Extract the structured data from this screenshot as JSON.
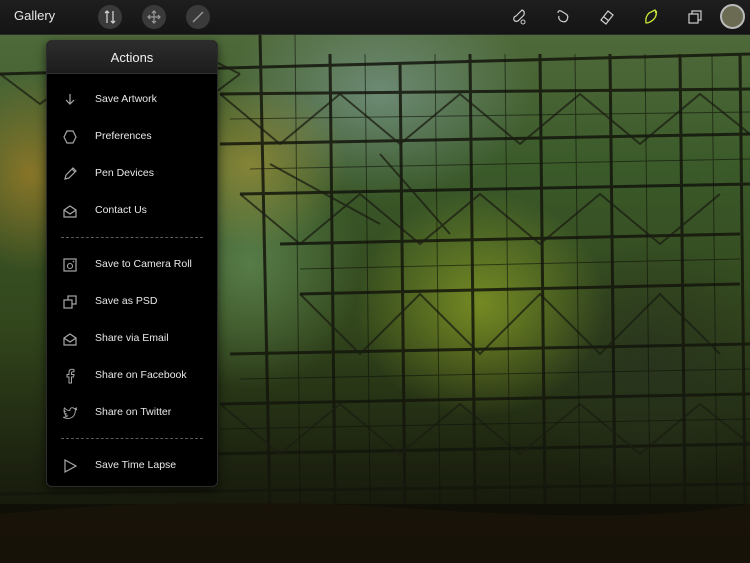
{
  "topbar": {
    "gallery_label": "Gallery",
    "left_tools": [
      {
        "icon": "adjust-arrows-icon"
      },
      {
        "icon": "move-selection-icon"
      },
      {
        "icon": "transform-icon"
      }
    ],
    "right_tools": [
      {
        "icon": "brush-icon"
      },
      {
        "icon": "smudge-icon"
      },
      {
        "icon": "eraser-icon"
      },
      {
        "icon": "layers-icon"
      }
    ],
    "active_tool_icon": "eraser-icon",
    "active_color": "#c8e83a",
    "swatch_color": "#6b6a52"
  },
  "actions_menu": {
    "title": "Actions",
    "group1": [
      {
        "label": "Save Artwork",
        "icon": "download-arrow-icon"
      },
      {
        "label": "Preferences",
        "icon": "hexagon-icon"
      },
      {
        "label": "Pen Devices",
        "icon": "pencil-icon"
      },
      {
        "label": "Contact Us",
        "icon": "envelope-open-icon"
      }
    ],
    "group2": [
      {
        "label": "Save to Camera Roll",
        "icon": "camera-icon"
      },
      {
        "label": "Save as PSD",
        "icon": "stacked-squares-icon"
      },
      {
        "label": "Share via Email",
        "icon": "envelope-open-icon"
      },
      {
        "label": "Share on Facebook",
        "icon": "facebook-icon"
      },
      {
        "label": "Share on Twitter",
        "icon": "twitter-bird-icon"
      }
    ],
    "group3": [
      {
        "label": "Save Time Lapse",
        "icon": "play-triangle-icon"
      }
    ]
  }
}
